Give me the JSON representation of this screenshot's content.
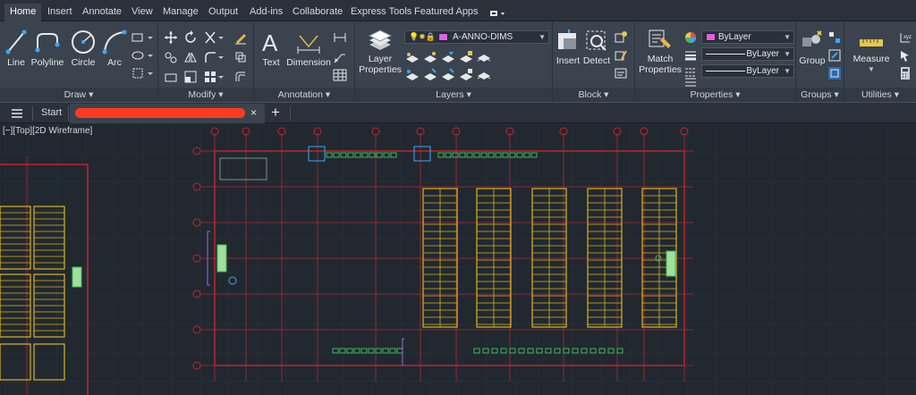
{
  "menu": {
    "tabs": [
      "Home",
      "Insert",
      "Annotate",
      "View",
      "Manage",
      "Output",
      "Add-ins",
      "Collaborate",
      "Express Tools",
      "Featured Apps"
    ],
    "active": "Home"
  },
  "ribbon": {
    "draw": {
      "title": "Draw",
      "line": "Line",
      "polyline": "Polyline",
      "circle": "Circle",
      "arc": "Arc"
    },
    "modify": {
      "title": "Modify"
    },
    "annotation": {
      "title": "Annotation",
      "text": "Text",
      "dimension": "Dimension"
    },
    "layers": {
      "title": "Layers",
      "layer_properties_1": "Layer",
      "layer_properties_2": "Properties",
      "current_layer": "A-ANNO-DIMS"
    },
    "block": {
      "title": "Block",
      "insert": "Insert",
      "detect": "Detect"
    },
    "properties": {
      "title": "Properties",
      "match_1": "Match",
      "match_2": "Properties",
      "color": "ByLayer",
      "linetype": "ByLayer",
      "lineweight": "ByLayer"
    },
    "groups": {
      "title": "Groups",
      "group": "Group"
    },
    "utilities": {
      "title": "Utilities",
      "measure": "Measure"
    }
  },
  "filetabs": {
    "start": "Start",
    "add_symbol": "+",
    "close_symbol": "×"
  },
  "viewport": {
    "label": "[−][Top][2D Wireframe]"
  },
  "colors": {
    "accent_red": "#c8232a",
    "grid_red": "#b02a30",
    "rack_yellow": "#d9b41c",
    "green": "#41b85a",
    "redaction": "#ff3b1f"
  }
}
